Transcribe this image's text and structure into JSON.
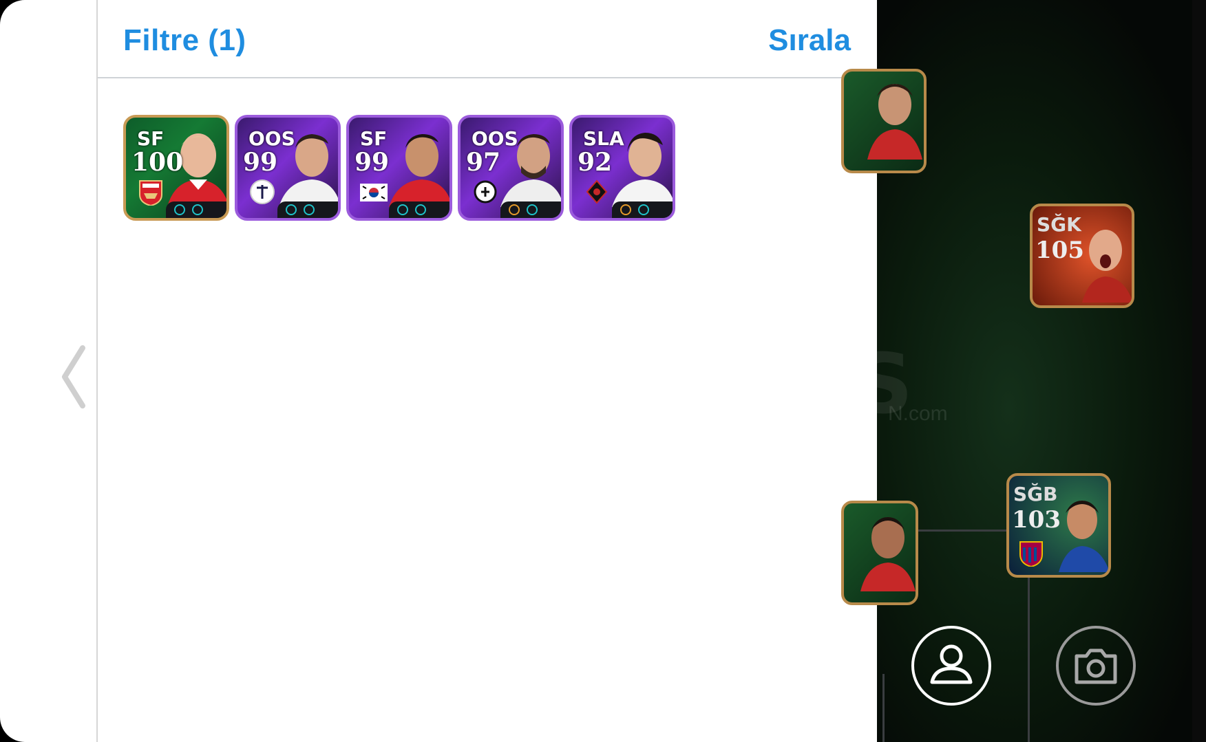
{
  "header": {
    "filter_label": "Filtre (1)",
    "sort_label": "Sırala"
  },
  "cards": [
    {
      "pos": "SF",
      "rating": "100",
      "style": "gold",
      "badge": "arsenal-crest-icon",
      "skills": [
        "teal",
        "teal"
      ]
    },
    {
      "pos": "OOS",
      "rating": "99",
      "style": "purple",
      "badge": "club-crest-icon",
      "skills": [
        "teal",
        "teal"
      ]
    },
    {
      "pos": "SF",
      "rating": "99",
      "style": "purple",
      "badge": "south-korea-flag-icon",
      "skills": [
        "teal",
        "teal"
      ]
    },
    {
      "pos": "OOS",
      "rating": "97",
      "style": "purple",
      "badge": "besiktas-crest-icon",
      "skills": [
        "orange",
        "teal"
      ]
    },
    {
      "pos": "SLA",
      "rating": "92",
      "style": "purple",
      "badge": "club-crest-icon",
      "skills": [
        "orange",
        "teal"
      ]
    }
  ],
  "field_cards": [
    {
      "pos": "SĞK",
      "rating": "105"
    },
    {
      "pos": "SĞB",
      "rating": "103"
    }
  ],
  "colors": {
    "accent": "#1f8de0",
    "gold_border": "#c89a55",
    "purple_border": "#9b5bdc"
  },
  "watermark": {
    "big": "S",
    "small": "N.com"
  }
}
